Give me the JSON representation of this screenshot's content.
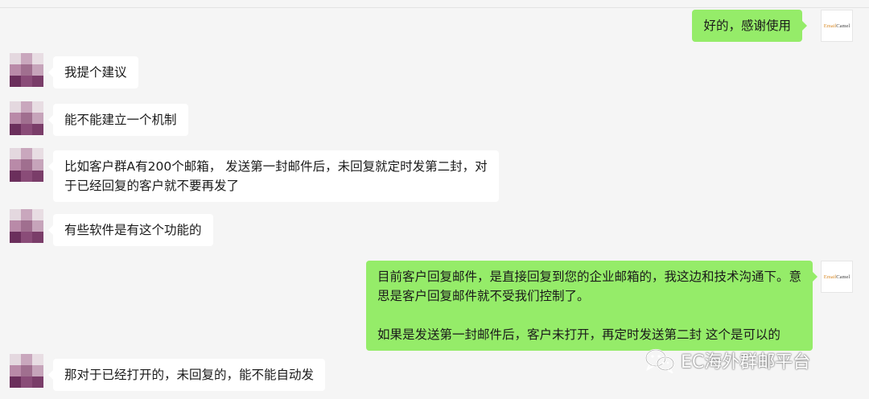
{
  "chat": {
    "messages": [
      {
        "sender": "self",
        "lines": [
          "好的，感谢使用"
        ]
      },
      {
        "sender": "other",
        "lines": [
          "我提个建议"
        ]
      },
      {
        "sender": "other",
        "lines": [
          "能不能建立一个机制"
        ]
      },
      {
        "sender": "other",
        "lines": [
          "比如客户群A有200个邮箱， 发送第一封邮件后，未回复就定时发第二封，对",
          "于已经回复的客户就不要再发了"
        ]
      },
      {
        "sender": "other",
        "lines": [
          "有些软件是有这个功能的"
        ]
      },
      {
        "sender": "self",
        "lines": [
          "目前客户回复邮件，是直接回复到您的企业邮箱的，我这边和技术沟通下。意",
          "思是客户回复邮件就不受我们控制了。",
          "",
          "如果是发送第一封邮件后，客户未打开，再定时发送第二封 这个是可以的"
        ]
      },
      {
        "sender": "other",
        "lines": [
          "那对于已经打开的，未回复的，能不能自动发"
        ]
      }
    ]
  },
  "brand_avatar": {
    "part1": "Email",
    "part2": "Camel"
  },
  "watermark": {
    "text": "EC海外群邮平台",
    "icon": "wechat-icon"
  },
  "colors": {
    "outgoing_bubble": "#95ec69",
    "incoming_bubble": "#ffffff",
    "background": "#f5f5f5"
  }
}
